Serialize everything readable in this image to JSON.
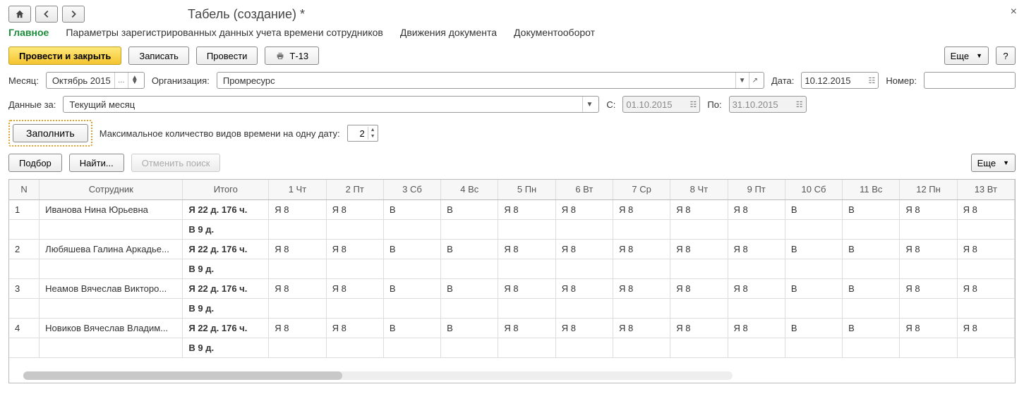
{
  "window": {
    "title": "Табель (создание) *"
  },
  "tabs": {
    "main": "Главное",
    "params": "Параметры зарегистрированных данных учета времени сотрудников",
    "movements": "Движения документа",
    "docflow": "Документооборот"
  },
  "actions": {
    "post_close": "Провести и закрыть",
    "write": "Записать",
    "post": "Провести",
    "t13": "Т-13",
    "more": "Еще",
    "help": "?"
  },
  "filters": {
    "month_label": "Месяц:",
    "month_value": "Октябрь 2015",
    "org_label": "Организация:",
    "org_value": "Промресурс",
    "date_label": "Дата:",
    "date_value": "10.12.2015",
    "number_label": "Номер:",
    "number_value": "",
    "range_label": "Данные за:",
    "range_value": "Текущий месяц",
    "from_label": "С:",
    "from_value": "01.10.2015",
    "to_label": "По:",
    "to_value": "31.10.2015"
  },
  "fill": {
    "button": "Заполнить",
    "maxkinds_label": "Максимальное количество видов времени на одну дату:",
    "maxkinds_value": "2"
  },
  "table_tools": {
    "pick": "Подбор",
    "find": "Найти...",
    "cancel_find": "Отменить поиск",
    "more": "Еще"
  },
  "grid": {
    "col_n": "N",
    "col_emp": "Сотрудник",
    "col_sum": "Итого",
    "days": [
      {
        "label": "1 Чт",
        "weekend": false
      },
      {
        "label": "2 Пт",
        "weekend": false
      },
      {
        "label": "3 Сб",
        "weekend": true
      },
      {
        "label": "4 Вс",
        "weekend": true
      },
      {
        "label": "5 Пн",
        "weekend": false
      },
      {
        "label": "6 Вт",
        "weekend": false
      },
      {
        "label": "7 Ср",
        "weekend": false
      },
      {
        "label": "8 Чт",
        "weekend": false
      },
      {
        "label": "9 Пт",
        "weekend": false
      },
      {
        "label": "10 Сб",
        "weekend": true
      },
      {
        "label": "11 Вс",
        "weekend": true
      },
      {
        "label": "12 Пн",
        "weekend": false
      },
      {
        "label": "13 Вт",
        "weekend": false
      }
    ],
    "rows": [
      {
        "n": "1",
        "emp": "Иванова Нина Юрьевна",
        "sum1": "Я 22 д. 176 ч.",
        "sum2": "В 9 д.",
        "cells": [
          "Я 8",
          "Я 8",
          "В",
          "В",
          "Я 8",
          "Я 8",
          "Я 8",
          "Я 8",
          "Я 8",
          "В",
          "В",
          "Я 8",
          "Я 8"
        ]
      },
      {
        "n": "2",
        "emp": "Любяшева Галина Аркадье...",
        "sum1": "Я 22 д. 176 ч.",
        "sum2": "В 9 д.",
        "cells": [
          "Я 8",
          "Я 8",
          "В",
          "В",
          "Я 8",
          "Я 8",
          "Я 8",
          "Я 8",
          "Я 8",
          "В",
          "В",
          "Я 8",
          "Я 8"
        ]
      },
      {
        "n": "3",
        "emp": "Неамов Вячеслав Викторо...",
        "sum1": "Я 22 д. 176 ч.",
        "sum2": "В 9 д.",
        "cells": [
          "Я 8",
          "Я 8",
          "В",
          "В",
          "Я 8",
          "Я 8",
          "Я 8",
          "Я 8",
          "Я 8",
          "В",
          "В",
          "Я 8",
          "Я 8"
        ]
      },
      {
        "n": "4",
        "emp": "Новиков Вячеслав Владим...",
        "sum1": "Я 22 д. 176 ч.",
        "sum2": "В 9 д.",
        "cells": [
          "Я 8",
          "Я 8",
          "В",
          "В",
          "Я 8",
          "Я 8",
          "Я 8",
          "Я 8",
          "Я 8",
          "В",
          "В",
          "Я 8",
          "Я 8"
        ]
      }
    ]
  }
}
